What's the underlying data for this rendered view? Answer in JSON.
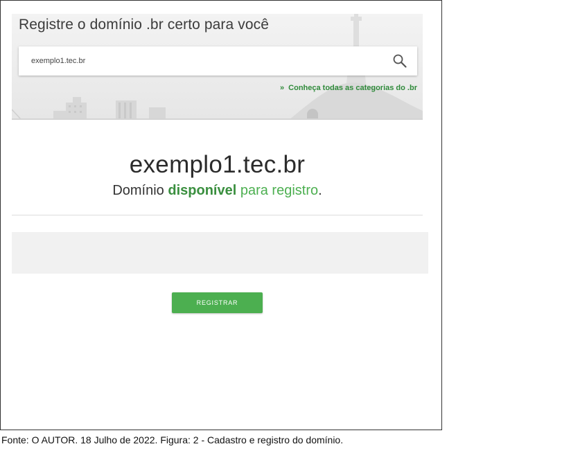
{
  "hero": {
    "title": "Registre o domínio .br certo para você",
    "search": {
      "value": "exemplo1.tec.br",
      "icon": "search-icon"
    },
    "categories_link": {
      "chevron": "»",
      "label": "Conheça todas as categorias do .br"
    }
  },
  "result": {
    "domain": "exemplo1.tec.br",
    "prefix": "Domínio ",
    "status": "disponível",
    "suffix": " para registro",
    "period": "."
  },
  "actions": {
    "register_label": "REGISTRAR"
  },
  "caption": "Fonte: O AUTOR. 18 Julho de 2022. Figura: 2 - Cadastro e registro do domínio.",
  "colors": {
    "accent_green": "#4caf50",
    "status_green": "#3a8f3f",
    "link_green": "#2f8a3a"
  }
}
